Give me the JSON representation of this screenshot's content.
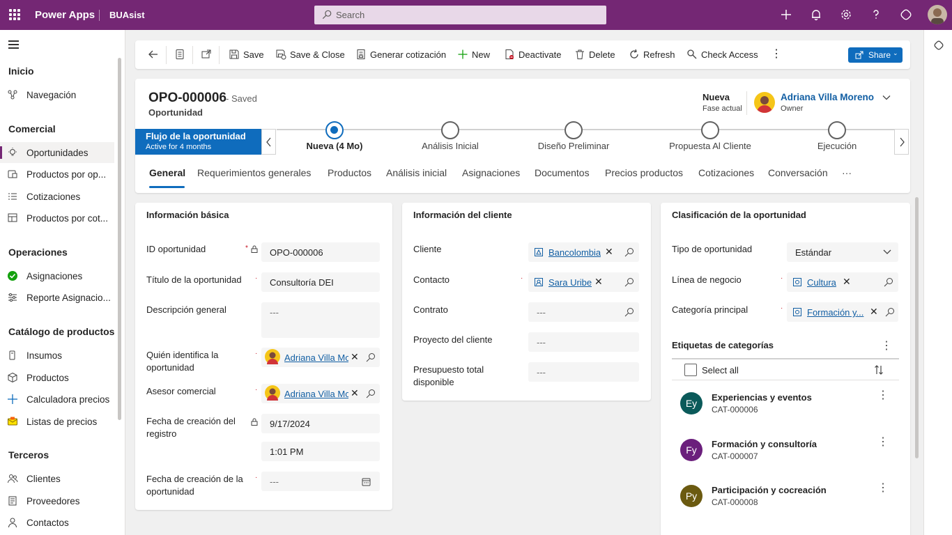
{
  "topbar": {
    "app_name": "Power Apps",
    "env_name": "BUAsist",
    "search_placeholder": "Search",
    "color": "#742774"
  },
  "leftnav": {
    "sections": [
      {
        "title": "Inicio",
        "items": [
          {
            "label": "Navegación",
            "icon": "navigation-icon"
          }
        ]
      },
      {
        "title": "Comercial",
        "items": [
          {
            "label": "Oportunidades",
            "icon": "lightbulb-icon"
          },
          {
            "label": "Productos por op...",
            "icon": "product-icon"
          },
          {
            "label": "Cotizaciones",
            "icon": "list-icon"
          },
          {
            "label": "Productos por cot...",
            "icon": "document-table-icon"
          }
        ]
      },
      {
        "title": "Operaciones",
        "items": [
          {
            "label": "Asignaciones",
            "icon": "check-circle-icon"
          },
          {
            "label": "Reporte Asignacio...",
            "icon": "report-icon"
          }
        ]
      },
      {
        "title": "Catálogo de productos",
        "items": [
          {
            "label": "Insumos",
            "icon": "document-icon"
          },
          {
            "label": "Productos",
            "icon": "cube-icon"
          },
          {
            "label": "Calculadora precios",
            "icon": "plus-icon"
          },
          {
            "label": "Listas de precios",
            "icon": "mail-icon"
          }
        ]
      },
      {
        "title": "Terceros",
        "items": [
          {
            "label": "Clientes",
            "icon": "people-icon"
          },
          {
            "label": "Proveedores",
            "icon": "document-icon"
          },
          {
            "label": "Contactos",
            "icon": "person-icon"
          }
        ]
      }
    ]
  },
  "commandbar": {
    "save": "Save",
    "save_close": "Save & Close",
    "generate_quote": "Generar cotización",
    "new": "New",
    "deactivate": "Deactivate",
    "delete": "Delete",
    "refresh": "Refresh",
    "check_access": "Check Access",
    "share": "Share"
  },
  "header": {
    "record_id": "OPO-000006",
    "status": "- Saved",
    "entity": "Oportunidad",
    "stage_name": "Nueva",
    "stage_label": "Fase actual",
    "owner_name": "Adriana Villa Moreno",
    "owner_label": "Owner"
  },
  "bpf": {
    "title": "Flujo de la oportunidad",
    "subtitle": "Active for 4 months",
    "stages": [
      "Nueva  (4 Mo)",
      "Análisis Inicial",
      "Diseño Preliminar",
      "Propuesta Al Cliente",
      "Ejecución"
    ],
    "accent": "#0f6cbd"
  },
  "tabs": [
    "General",
    "Requerimientos generales",
    "Productos",
    "Análisis inicial",
    "Asignaciones",
    "Documentos",
    "Precios productos",
    "Cotizaciones",
    "Conversación",
    "···"
  ],
  "info_basica": {
    "title": "Información básica",
    "id_label": "ID oportunidad",
    "id_value": "OPO-000006",
    "titulo_label": "Título de la oportunidad",
    "titulo_value": "Consultoría DEI",
    "desc_label": "Descripción general",
    "desc_value": "---",
    "quien_label": "Quién identifica la oportunidad",
    "quien_value": "Adriana Villa Mo",
    "asesor_label": "Asesor comercial",
    "asesor_value": "Adriana Villa Mo",
    "fecha_reg_label": "Fecha de creación del registro",
    "fecha_reg_date": "9/17/2024",
    "fecha_reg_time": "1:01 PM",
    "fecha_op_label": "Fecha de creación de la oportunidad",
    "fecha_op_value": "---",
    "required_mark": "*"
  },
  "info_cliente": {
    "title": "Información del cliente",
    "cliente_label": "Cliente",
    "cliente_value": "Bancolombia",
    "contacto_label": "Contacto",
    "contacto_value": "Sara Uribe",
    "contrato_label": "Contrato",
    "contrato_value": "---",
    "proyecto_label": "Proyecto del cliente",
    "proyecto_value": "---",
    "presupuesto_label": "Presupuesto total disponible",
    "presupuesto_value": "---"
  },
  "clasificacion": {
    "title": "Clasificación de la oportunidad",
    "tipo_label": "Tipo de oportunidad",
    "tipo_value": "Estándar",
    "linea_label": "Línea de negocio",
    "linea_value": "Cultura",
    "categoria_label": "Categoría principal",
    "categoria_value": "Formación y...",
    "etiquetas_title": "Etiquetas de categorías",
    "select_all": "Select all",
    "rows": [
      {
        "initials": "Ey",
        "name": "Experiencias y eventos",
        "code": "CAT-000006",
        "color": "#0b5a5a"
      },
      {
        "initials": "Fy",
        "name": "Formación y consultoría",
        "code": "CAT-000007",
        "color": "#6b1f7c"
      },
      {
        "initials": "Py",
        "name": "Participación y cocreación",
        "code": "CAT-000008",
        "color": "#6b5a10"
      }
    ]
  }
}
